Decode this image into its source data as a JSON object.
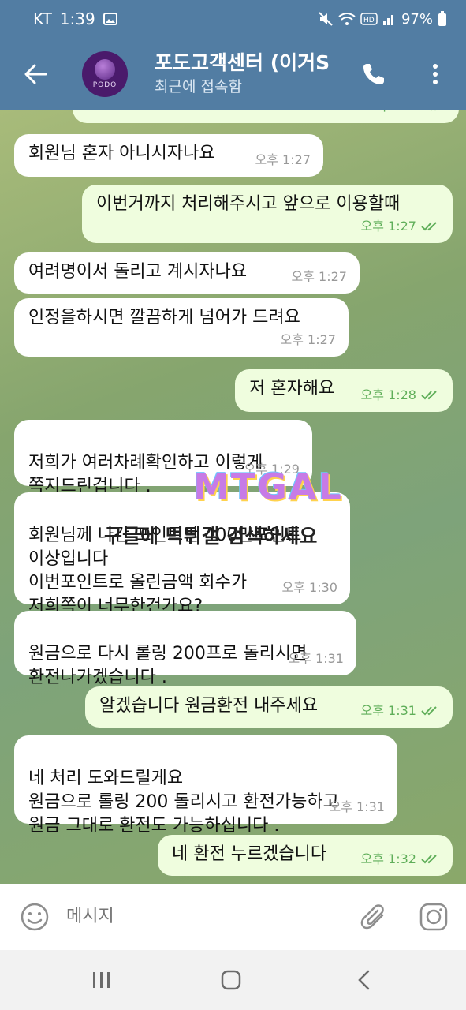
{
  "status_bar": {
    "carrier": "KT",
    "time": "1:39",
    "battery": "97%"
  },
  "header": {
    "title": "포도고객센터 (이거S",
    "subtitle": "최근에 접속함",
    "avatar_text": "PODO"
  },
  "messages": [
    {
      "dir": "out",
      "text": "",
      "time": "오후 1:27"
    },
    {
      "dir": "in",
      "text": "회원님 혼자 아니시자나요",
      "time": "오후 1:27"
    },
    {
      "dir": "out",
      "text": "이번거까지 처리해주시고 앞으로 이용할때",
      "time": "오후 1:27"
    },
    {
      "dir": "in",
      "text": "여려명이서 돌리고 계시자나요",
      "time": "오후 1:27"
    },
    {
      "dir": "in",
      "text": "인정을하시면 깔끔하게 넘어가 드려요",
      "time": "오후 1:27"
    },
    {
      "dir": "out",
      "text": "저 혼자해요",
      "time": "오후 1:28"
    },
    {
      "dir": "in",
      "text": "저희가 여러차례확인하고 이렇게\n쪽지드린겁니다 .",
      "time": "오후 1:29"
    },
    {
      "dir": "in",
      "text": "회원님께 나간 포인트만 400만포인트\n이상입니다\n이번포인트로 올린금액 회수가\n저희쪽이 너무한건가요?",
      "time": "오후 1:30"
    },
    {
      "dir": "in",
      "text": "원금으로 다시 롤링 200프로 돌리시면\n환전나가겠습니다 .",
      "time": "오후 1:31"
    },
    {
      "dir": "out",
      "text": "알겠습니다 원금환전 내주세요",
      "time": "오후 1:31"
    },
    {
      "dir": "in",
      "text": "네 처리 도와드릴게요\n원금으로 롤링 200 돌리시고 환전가능하고\n원금 그대로 환전도 가능하십니다 .",
      "time": "오후 1:31"
    },
    {
      "dir": "out",
      "text": "네 환전 누르겠습니다",
      "time": "오후 1:32"
    }
  ],
  "watermark": {
    "logo": "MTGAL",
    "text": "구글에 먹튀갤 검색하세요"
  },
  "input": {
    "placeholder": "메시지"
  },
  "colors": {
    "header": "#527da3",
    "bubble_in": "#ffffff",
    "bubble_out": "#effdde",
    "tick": "#5fae59"
  }
}
